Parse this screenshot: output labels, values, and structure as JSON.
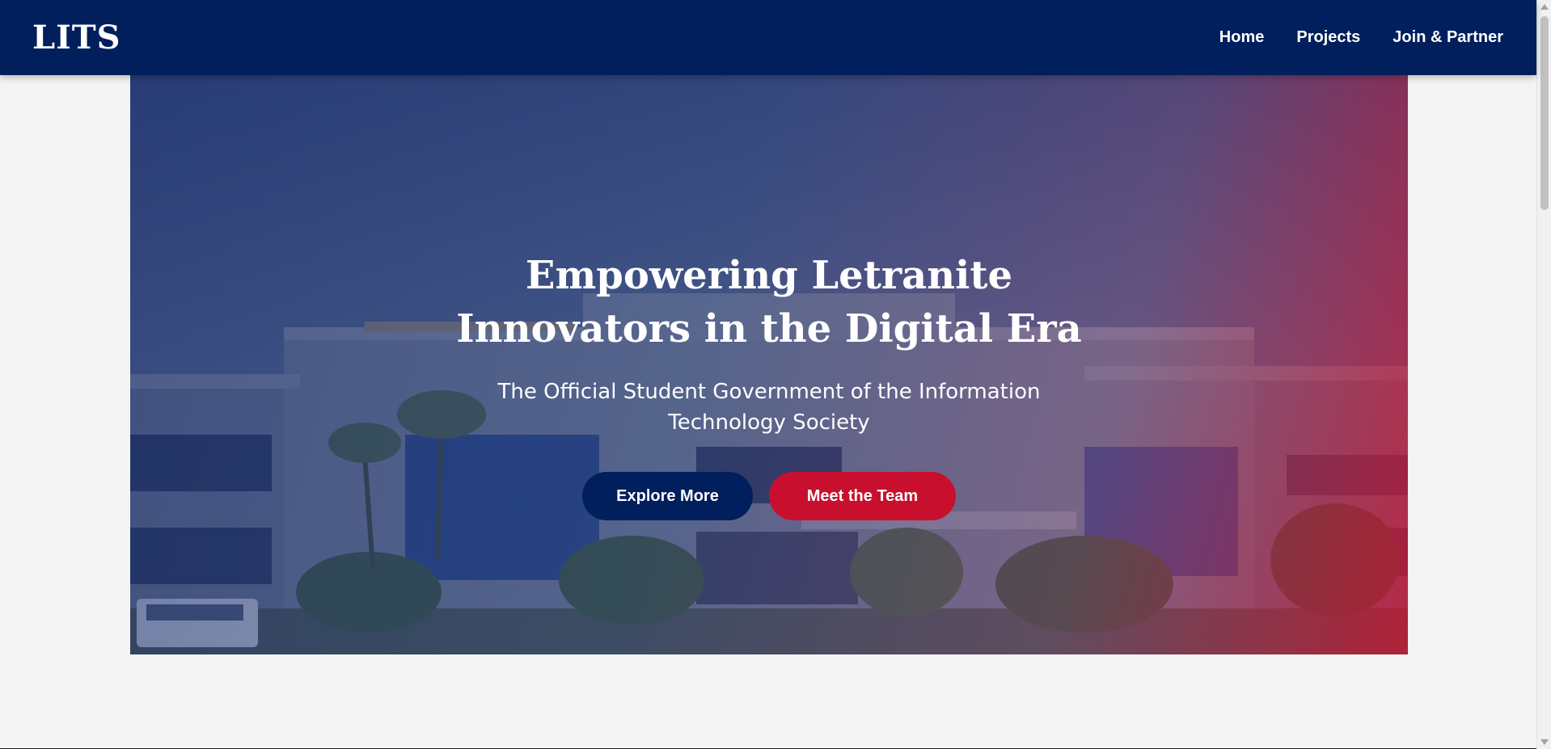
{
  "nav": {
    "logo": "LITS",
    "links": [
      "Home",
      "Projects",
      "Join & Partner"
    ]
  },
  "hero": {
    "title": "Empowering Letranite Innovators in the Digital Era",
    "subtitle": "The Official Student Government of the Information Technology Society",
    "primary_button": "Explore More",
    "secondary_button": "Meet the Team"
  },
  "colors": {
    "navy": "#001f5c",
    "red": "#c8102e",
    "background": "#f4f4f4"
  }
}
